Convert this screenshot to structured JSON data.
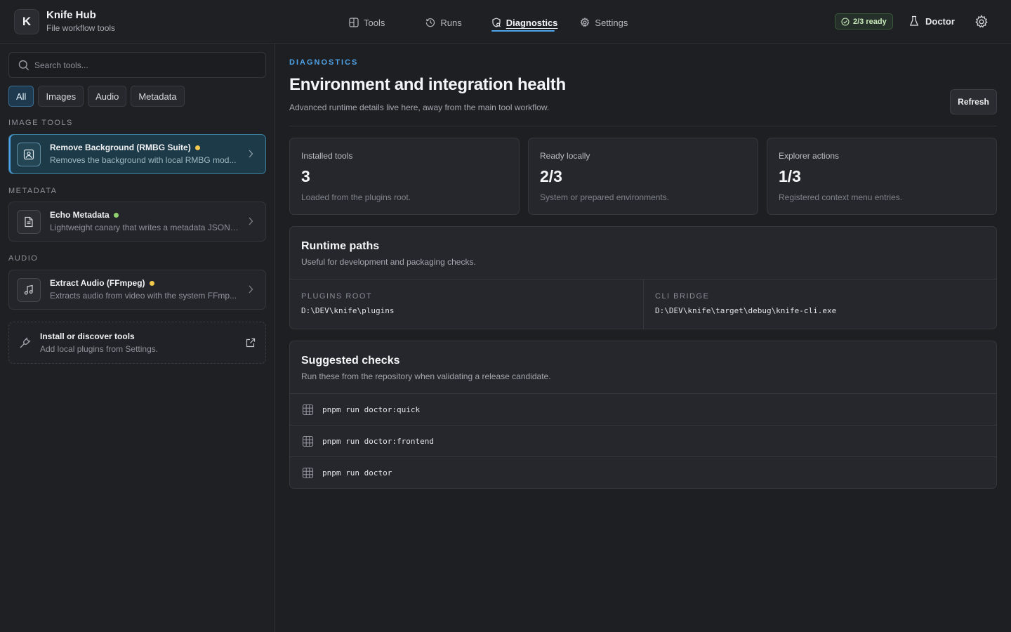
{
  "app": {
    "logo_letter": "K",
    "title": "Knife Hub",
    "subtitle": "File workflow tools"
  },
  "nav": [
    {
      "label": "Tools",
      "icon": "grid-icon",
      "active": false
    },
    {
      "label": "Runs",
      "icon": "history-icon",
      "active": false
    },
    {
      "label": "Diagnostics",
      "icon": "shield-icon",
      "active": true
    },
    {
      "label": "Settings",
      "icon": "gear-icon",
      "active": false
    }
  ],
  "header_right": {
    "ready_badge": "2/3 ready",
    "doctor_label": "Doctor"
  },
  "sidebar": {
    "search_placeholder": "Search tools...",
    "filters": [
      {
        "label": "All",
        "active": true
      },
      {
        "label": "Images",
        "active": false
      },
      {
        "label": "Audio",
        "active": false
      },
      {
        "label": "Metadata",
        "active": false
      }
    ],
    "groups": [
      {
        "label": "IMAGE TOOLS",
        "tools": [
          {
            "name": "Remove Background (RMBG Suite)",
            "description": "Removes the background with local RMBG mod...",
            "status_color": "#f2c94c",
            "icon": "image-icon",
            "selected": true
          }
        ]
      },
      {
        "label": "METADATA",
        "tools": [
          {
            "name": "Echo Metadata",
            "description": "Lightweight canary that writes a metadata JSON ...",
            "status_color": "#8fd16f",
            "icon": "document-icon",
            "selected": false
          }
        ]
      },
      {
        "label": "AUDIO",
        "tools": [
          {
            "name": "Extract Audio (FFmpeg)",
            "description": "Extracts audio from video with the system FFmp...",
            "status_color": "#f2c94c",
            "icon": "music-icon",
            "selected": false
          }
        ]
      }
    ],
    "install": {
      "title": "Install or discover tools",
      "subtitle": "Add local plugins from Settings."
    }
  },
  "main": {
    "eyebrow": "DIAGNOSTICS",
    "title": "Environment and integration health",
    "subtitle": "Advanced runtime details live here, away from the main tool workflow.",
    "refresh_label": "Refresh",
    "stats": [
      {
        "label": "Installed tools",
        "value": "3",
        "note": "Loaded from the plugins root."
      },
      {
        "label": "Ready locally",
        "value": "2/3",
        "note": "System or prepared environments."
      },
      {
        "label": "Explorer actions",
        "value": "1/3",
        "note": "Registered context menu entries."
      }
    ],
    "runtime": {
      "title": "Runtime paths",
      "subtitle": "Useful for development and packaging checks.",
      "paths": [
        {
          "label": "PLUGINS ROOT",
          "value": "D:\\DEV\\knife\\plugins"
        },
        {
          "label": "CLI BRIDGE",
          "value": "D:\\DEV\\knife\\target\\debug\\knife-cli.exe"
        }
      ]
    },
    "checks": {
      "title": "Suggested checks",
      "subtitle": "Run these from the repository when validating a release candidate.",
      "commands": [
        "pnpm run doctor:quick",
        "pnpm run doctor:frontend",
        "pnpm run doctor"
      ]
    }
  },
  "colors": {
    "accent": "#4fa3e8",
    "ready_green": "#8fd16f",
    "warning_yellow": "#f2c94c"
  }
}
